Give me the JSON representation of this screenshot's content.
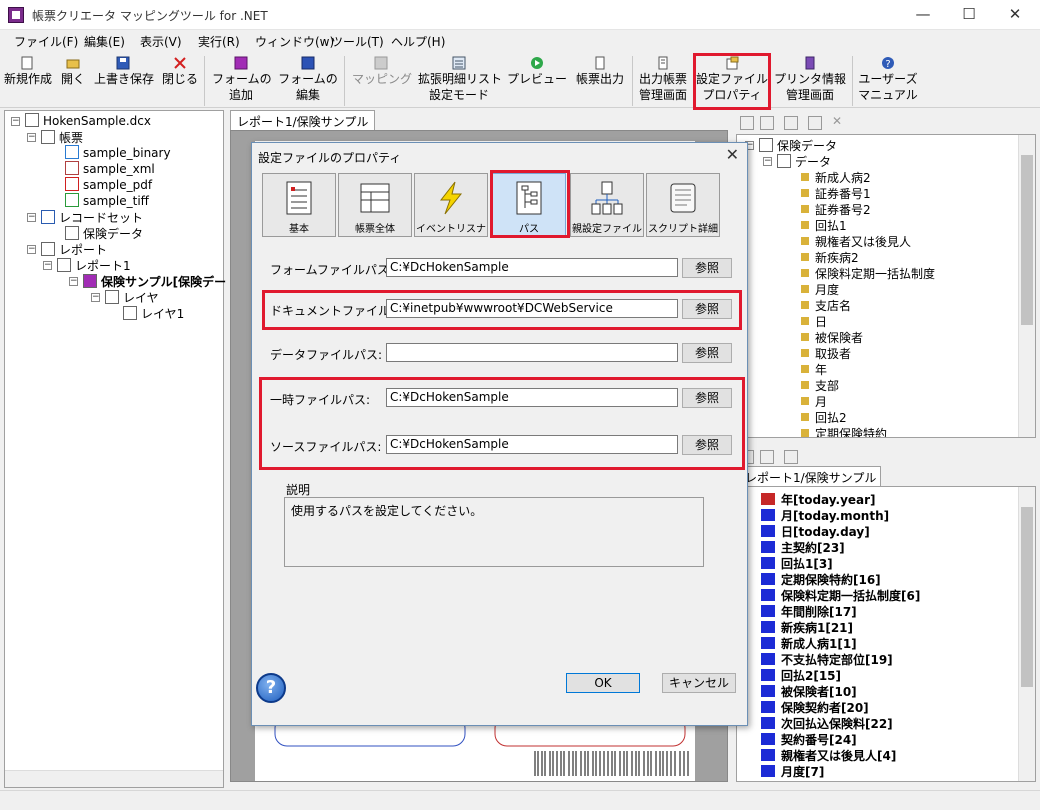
{
  "window": {
    "title": "帳票クリエータ マッピングツール for .NET",
    "controls": [
      "—",
      "☐",
      "✕"
    ]
  },
  "menu": [
    "ファイル(F)",
    "編集(E)",
    "表示(V)",
    "実行(R)",
    "ウィンドウ(w)",
    "ツール(T)",
    "ヘルプ(H)"
  ],
  "toolbar": [
    {
      "label": "新規作成",
      "icon": "new-document-icon"
    },
    {
      "label": "開く",
      "icon": "open-folder-icon"
    },
    {
      "label": "上書き保存",
      "icon": "save-icon"
    },
    {
      "label": "閉じる",
      "icon": "close-icon"
    },
    {
      "label": "フォームの\n追加",
      "icon": "add-form-icon"
    },
    {
      "label": "フォームの\n編集",
      "icon": "edit-form-icon"
    },
    {
      "label": "マッピング",
      "icon": "mapping-icon",
      "disabled": true
    },
    {
      "label": "拡張明細リスト\n設定モード",
      "icon": "list-mode-icon"
    },
    {
      "label": "プレビュー",
      "icon": "preview-icon"
    },
    {
      "label": "帳票出力",
      "icon": "output-icon"
    },
    {
      "label": "出力帳票\n管理画面",
      "icon": "output-manage-icon"
    },
    {
      "label": "設定ファイル\nプロパティ",
      "icon": "settings-file-icon"
    },
    {
      "label": "プリンタ情報\n管理画面",
      "icon": "printer-icon"
    },
    {
      "label": "ユーザーズ\nマニュアル",
      "icon": "help-icon"
    }
  ],
  "project_tree": [
    {
      "label": "HokenSample.dcx",
      "level": 0
    },
    {
      "label": "帳票",
      "level": 1
    },
    {
      "label": "sample_binary",
      "level": 2,
      "icon_text": "BIN"
    },
    {
      "label": "sample_xml",
      "level": 2,
      "icon_text": "XML"
    },
    {
      "label": "sample_pdf",
      "level": 2,
      "icon_text": "PDF"
    },
    {
      "label": "sample_tiff",
      "level": 2,
      "icon_text": "TIFF"
    },
    {
      "label": "レコードセット",
      "level": 1
    },
    {
      "label": "保険データ",
      "level": 2
    },
    {
      "label": "レポート",
      "level": 1
    },
    {
      "label": "レポート1",
      "level": 2
    },
    {
      "label": "保険サンプル[保険デー",
      "level": 3,
      "bold": true
    },
    {
      "label": "レイヤ",
      "level": 4
    },
    {
      "label": "レイヤ1",
      "level": 5
    }
  ],
  "doc_tab": "レポート1/保険サンプル",
  "data_tree": {
    "root": "保険データ",
    "child": "データ",
    "items": [
      "新成人病2",
      "証券番号1",
      "証券番号2",
      "回払1",
      "親権者又は後見人",
      "新疾病2",
      "保険料定期一括払制度",
      "月度",
      "支店名",
      "日",
      "被保険者",
      "取扱者",
      "年",
      "支部",
      "月",
      "回払2",
      "定期保険特約"
    ]
  },
  "fields_tab": "レポート1/保険サンプル",
  "fields": [
    "年[today.year]",
    "月[today.month]",
    "日[today.day]",
    "主契約[23]",
    "回払1[3]",
    "定期保険特約[16]",
    "保険料定期一括払制度[6]",
    "年間削除[17]",
    "新疾病1[21]",
    "新成人病1[1]",
    "不支払特定部位[19]",
    "回払2[15]",
    "被保険者[10]",
    "保険契約者[20]",
    "次回払込保険料[22]",
    "契約番号[24]",
    "親権者又は後見人[4]",
    "月度[7]"
  ],
  "dialog": {
    "title": "設定ファイルのプロパティ",
    "tabs": [
      "基本",
      "帳票全体",
      "イベントリスナ",
      "パス",
      "親設定ファイル",
      "スクリプト詳細"
    ],
    "selected_tab": 3,
    "browse_label": "参照",
    "rows": [
      {
        "label": "フォームファイルパス:",
        "value": "C:¥DcHokenSample"
      },
      {
        "label": "ドキュメントファイルパス:",
        "value": "C:¥inetpub¥wwwroot¥DCWebService"
      },
      {
        "label": "データファイルパス:",
        "value": ""
      },
      {
        "label": "一時ファイルパス:",
        "value": "C:¥DcHokenSample"
      },
      {
        "label": "ソースファイルパス:",
        "value": "C:¥DcHokenSample"
      }
    ],
    "description_title": "説明",
    "description": "使用するパスを設定してください。",
    "ok": "OK",
    "cancel": "キャンセル",
    "help": "?"
  },
  "colors": {
    "highlight": "#e0192e",
    "field_icon": "#1c2bd6",
    "accent": "#0078d7"
  }
}
